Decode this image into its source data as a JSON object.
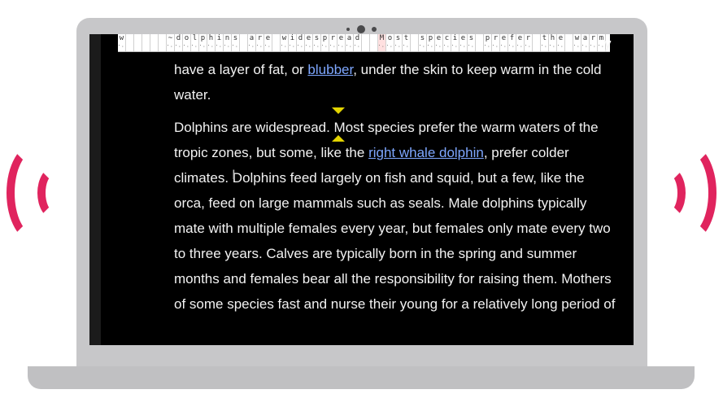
{
  "braille_display": {
    "cells": [
      "w",
      "",
      "",
      "",
      "",
      "",
      "~",
      "d",
      "o",
      "l",
      "p",
      "h",
      "i",
      "n",
      "s",
      "",
      "a",
      "r",
      "e",
      "",
      "w",
      "i",
      "d",
      "e",
      "s",
      "p",
      "r",
      "e",
      "a",
      "d",
      "",
      "",
      "M",
      "o",
      "s",
      "t",
      "",
      "s",
      "p",
      "e",
      "c",
      "i",
      "e",
      "s",
      "",
      "p",
      "r",
      "e",
      "f",
      "e",
      "r",
      "",
      "t",
      "h",
      "e",
      "",
      "w",
      "a",
      "r",
      "m"
    ],
    "highlight_index": 32
  },
  "document": {
    "partial_line_tail": "y",
    "paragraph1": {
      "line1_before_link": "have a layer of fat, or ",
      "line1_link": "blubber",
      "line1_after_link": ", under the skin to keep warm in the cold",
      "line2": "water."
    },
    "paragraph2": {
      "line1": "Dolphins are widespread. Most species prefer the warm waters of the",
      "line2_before_link": "tropic zones, but some, like the ",
      "line2_link": "right whale dolphin",
      "line2_after_link": ", prefer colder",
      "line3": "climates. Dolphins feed largely on fish and squid, but a few, like the",
      "line4": "orca, feed on large mammals such as seals. Male dolphins typically",
      "line5": "mate with multiple females every year, but females only mate every two",
      "line6": "to three years. Calves are typically born in the spring and summer",
      "line7": "months and females bear all the responsibility for raising them. Mothers",
      "line8": "of some species fast and nurse their young for a relatively long period of"
    }
  },
  "colors": {
    "accent_waves": "#e0245e",
    "link": "#7ea7ff",
    "caret": "#e3d400"
  },
  "icons": {
    "sound_waves_left": "sound-waves-icon",
    "sound_waves_right": "sound-waves-icon",
    "reading_caret": "triangle-caret-icon"
  }
}
